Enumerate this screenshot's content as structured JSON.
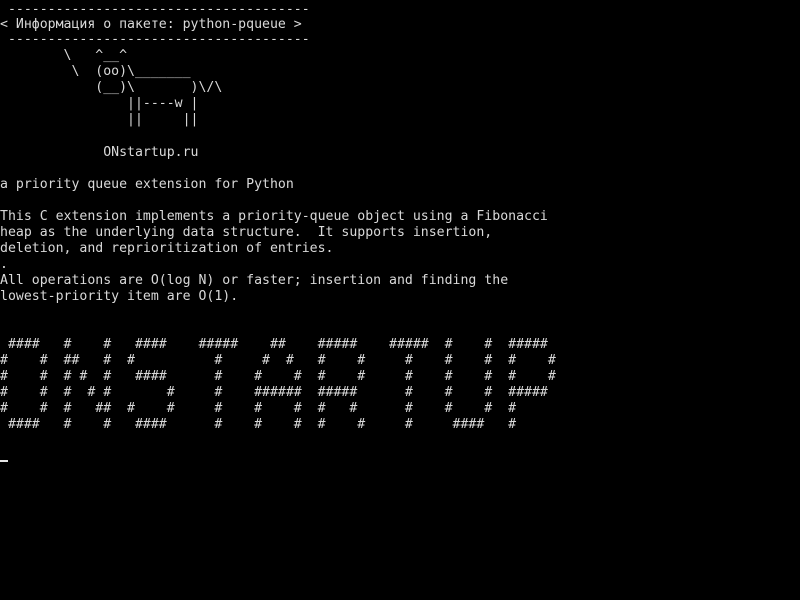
{
  "terminal": {
    "cowsay": {
      "bubble_top": " --------------------------------------",
      "bubble_text": "< Информация о пакете: python-pqueue >",
      "bubble_bottom": " --------------------------------------",
      "cow_line_1": "        \\   ^__^",
      "cow_line_2": "         \\  (oo)\\_______",
      "cow_line_3": "            (__)\\       )\\/\\",
      "cow_line_4": "                ||----w |",
      "cow_line_5": "                ||     ||"
    },
    "site_name": "             ONstartup.ru",
    "package": {
      "summary": "a priority queue extension for Python",
      "description": [
        "This C extension implements a priority-queue object using a Fibonacci",
        "heap as the underlying data structure.  It supports insertion,",
        "deletion, and reprioritization of entries.",
        ".",
        "All operations are O(log N) or faster; insertion and finding the",
        "lowest-priority item are O(1)."
      ]
    },
    "banner": [
      " ####   #    #   ####    #####    ##    #####    #####  #    #  #####",
      "#    #  ##   #  #          #     #  #   #    #     #    #    #  #    #",
      "#    #  # #  #   ####      #    #    #  #    #     #    #    #  #    #",
      "#    #  #  # #       #     #    ######  #####      #    #    #  #####",
      "#    #  #   ##  #    #     #    #    #  #   #      #    #    #  #",
      " ####   #    #   ####      #    #    #  #    #     #     ####   #"
    ]
  }
}
